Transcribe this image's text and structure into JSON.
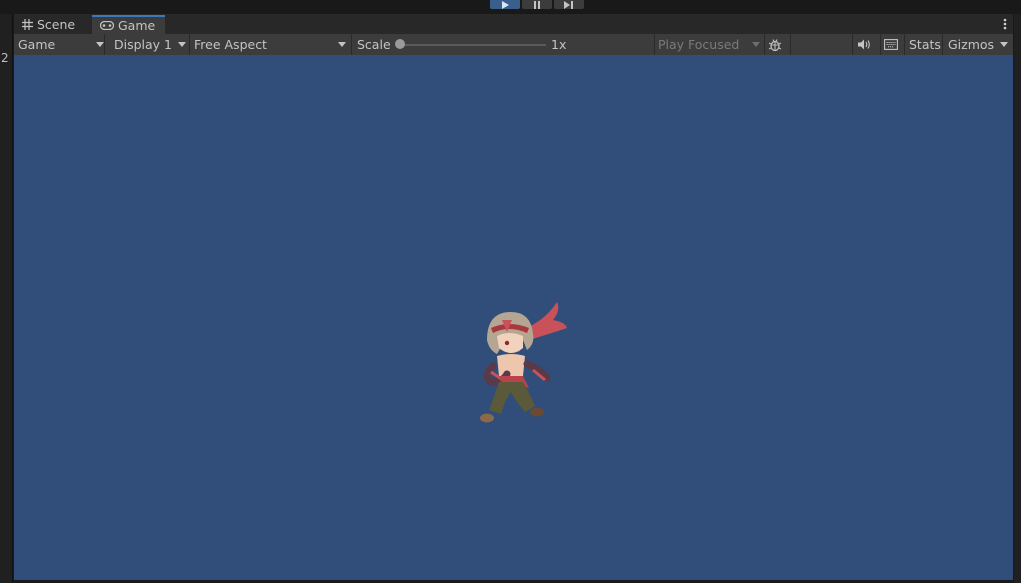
{
  "playbar": {
    "play_icon": "play-icon",
    "pause_icon": "pause-icon",
    "step_icon": "step-icon"
  },
  "left_panel": {
    "number": "2"
  },
  "tabs": [
    {
      "label": "Scene",
      "icon": "grid-icon"
    },
    {
      "label": "Game",
      "icon": "gamepad-icon"
    }
  ],
  "toolbar": {
    "view_mode": "Game",
    "display": "Display 1",
    "aspect": "Free Aspect",
    "scale_label": "Scale",
    "scale_value": "1x",
    "scale_level": 0.0,
    "play_mode": "Play Focused",
    "stats_label": "Stats",
    "gizmos_label": "Gizmos"
  },
  "colors": {
    "accent": "#3a79bb",
    "game_background": "#314d79",
    "panel": "#3c3c3c"
  }
}
